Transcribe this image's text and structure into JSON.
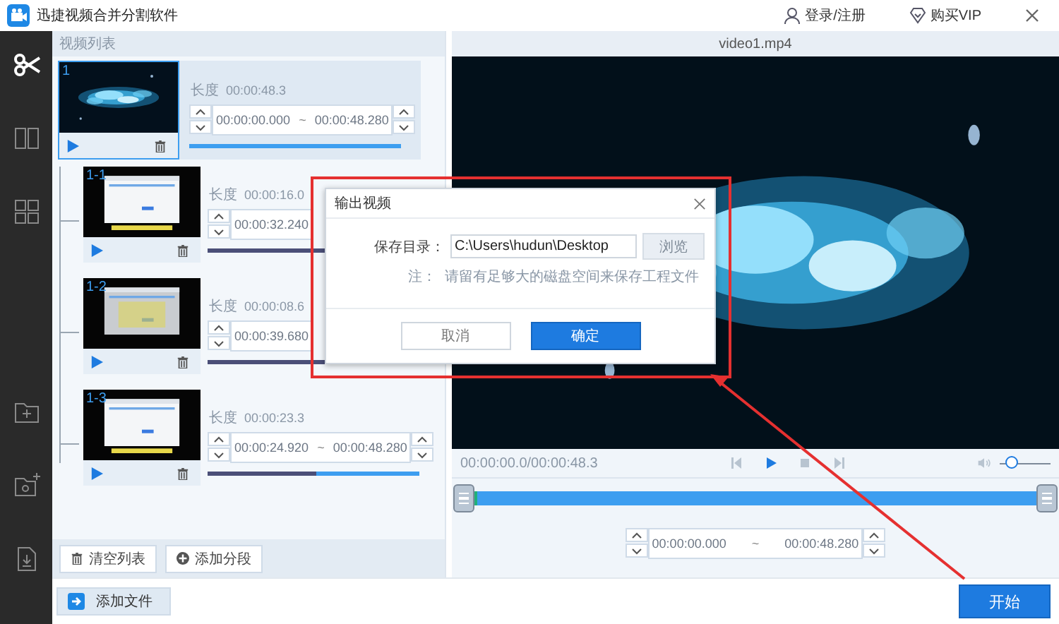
{
  "window": {
    "title": "迅捷视频合并分割软件",
    "login": "登录/注册",
    "vip": "购买VIP"
  },
  "sidebar": {
    "items": [
      {
        "kind": "scissors",
        "selected": true
      },
      {
        "kind": "columns",
        "selected": false
      },
      {
        "kind": "grid",
        "selected": false
      },
      {
        "kind": "folder-add",
        "selected": false
      },
      {
        "kind": "folder-gear",
        "selected": false
      },
      {
        "kind": "export",
        "selected": false
      }
    ]
  },
  "video_list": {
    "title": "视频列表",
    "items": [
      {
        "label": "1",
        "duration_label": "长度",
        "duration": "00:00:48.3",
        "start": "00:00:00.000",
        "separator": "~",
        "end": "00:00:48.280",
        "level": 0,
        "selected": true,
        "children": [
          {
            "label": "1-1",
            "duration_label": "长度",
            "duration": "00:00:16.0",
            "start": "00:00:32.240",
            "level": 0.67
          },
          {
            "label": "1-2",
            "duration_label": "长度",
            "duration": "00:00:08.6",
            "start": "00:00:39.680",
            "level": 0.82
          },
          {
            "label": "1-3",
            "duration_label": "长度",
            "duration": "00:00:23.3",
            "start": "00:00:24.920",
            "separator": "~",
            "end": "00:00:48.280",
            "level": 0.51
          }
        ]
      }
    ]
  },
  "list_buttons": [
    {
      "kind": "clear",
      "label": "清空列表"
    },
    {
      "kind": "add",
      "label": "添加分段"
    }
  ],
  "add_file": "添加文件",
  "player": {
    "title": "video1.mp4",
    "time": "00:00:00.0/00:00:48.3",
    "volume": {
      "level": 0.25
    }
  },
  "range": {
    "start": "00:00:00.000",
    "separator": "~",
    "end": "00:00:48.280"
  },
  "start_button": "开始",
  "dialog": {
    "title": "输出视频",
    "label": "保存目录：",
    "value": "C:\\Users\\hudun\\Desktop",
    "browse": "浏览",
    "note_label": "注：",
    "note": "请留有足够大的磁盘空间来保存工程文件",
    "buttons": [
      {
        "label": "取消",
        "primary": false
      },
      {
        "label": "确定",
        "primary": true
      }
    ]
  }
}
